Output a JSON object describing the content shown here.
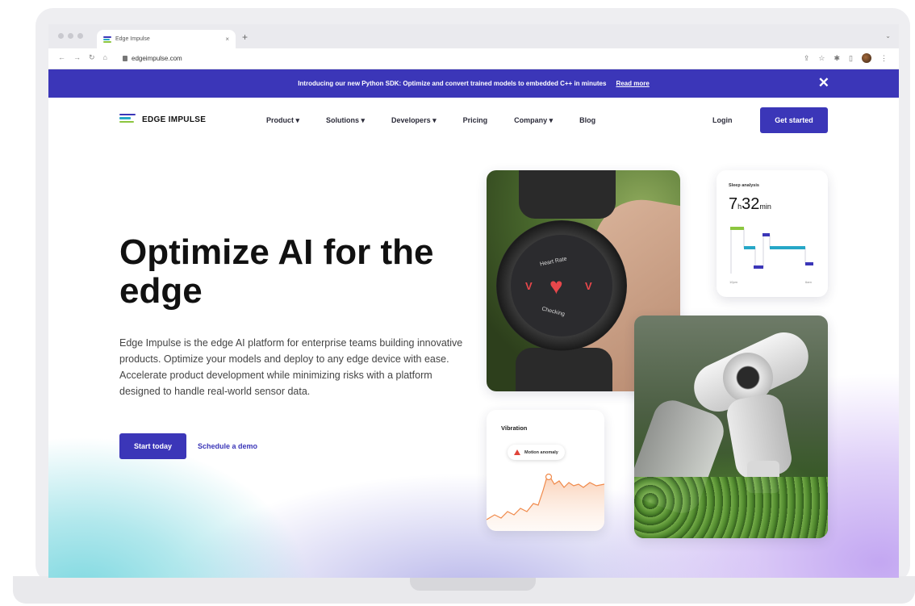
{
  "browser": {
    "tab_title": "Edge Impulse",
    "tab_close": "×",
    "new_tab": "+",
    "tab_menu": "⌄",
    "url": "edgeimpulse.com",
    "nav_back": "←",
    "nav_forward": "→",
    "nav_reload": "↻",
    "nav_home": "⌂"
  },
  "announcement": {
    "text": "Introducing our new Python SDK: Optimize and convert trained models to embedded C++ in minutes",
    "link": "Read more",
    "close": "✕"
  },
  "nav": {
    "logo_text": "EDGE IMPULSE",
    "items": [
      "Product ▾",
      "Solutions ▾",
      "Developers ▾",
      "Pricing",
      "Company ▾",
      "Blog"
    ],
    "login": "Login",
    "get_started": "Get started"
  },
  "hero": {
    "title": "Optimize AI for the edge",
    "description": "Edge Impulse is the edge AI platform for enterprise teams building innovative products. Optimize your models and deploy to any edge device with ease. Accelerate product development while minimizing risks with a platform designed to handle real-world sensor data.",
    "cta_primary": "Start today",
    "cta_secondary": "Schedule a demo"
  },
  "watch": {
    "top_text": "Heart Rate",
    "bottom_text": "Checking",
    "heart": "♥",
    "v": "V"
  },
  "sleep": {
    "title": "Sleep analysis",
    "hours": "7",
    "hours_unit": "h",
    "minutes": "32",
    "minutes_unit": "min",
    "axis_start": "10pm",
    "axis_end": "6am"
  },
  "vibration": {
    "title": "Vibration",
    "badge": "Motion anomaly"
  },
  "colors": {
    "brand": "#3b36b8",
    "sleep_green": "#8cc63f",
    "sleep_blue": "#3b36b8",
    "sleep_teal": "#26a7c7",
    "vibration_line": "#f08a4b",
    "alert": "#e0443a"
  }
}
